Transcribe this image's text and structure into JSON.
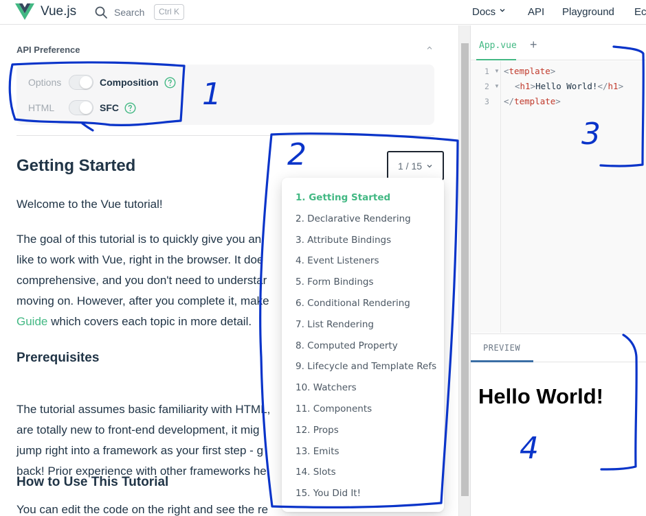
{
  "topnav": {
    "brand": "Vue.js",
    "search_label": "Search",
    "search_shortcut": "Ctrl K",
    "items": [
      "Docs",
      "API",
      "Playground",
      "Ec"
    ]
  },
  "api_preference": {
    "header": "API Preference",
    "row1": {
      "off": "Options",
      "on": "Composition"
    },
    "row2": {
      "off": "HTML",
      "on": "SFC"
    }
  },
  "tutorial": {
    "title": "Getting Started",
    "step": "1 / 15",
    "paragraphs": {
      "p1": "Welcome to the Vue tutorial!",
      "p2_lines": [
        "The goal of this tutorial is to quickly give you an",
        "like to work with Vue, right in the browser. It doe",
        "comprehensive, and you don't need to understar",
        "moving on. However, after you complete it, make"
      ],
      "p2_link": "Guide",
      "p2_tail": " which covers each topic in more detail.",
      "h_prereq": "Prerequisites",
      "p3_lines": [
        "The tutorial assumes basic familiarity with HTML,",
        "are totally new to front-end development, it mig",
        "jump right into a framework as your first step - g",
        "back! Prior experience with other frameworks he"
      ],
      "h_howto": "How to Use This Tutorial",
      "p4": "You can edit the code on the right and see the re"
    },
    "steps": [
      "1. Getting Started",
      "2. Declarative Rendering",
      "3. Attribute Bindings",
      "4. Event Listeners",
      "5. Form Bindings",
      "6. Conditional Rendering",
      "7. List Rendering",
      "8. Computed Property",
      "9. Lifecycle and Template Refs",
      "10. Watchers",
      "11. Components",
      "12. Props",
      "13. Emits",
      "14. Slots",
      "15. You Did It!"
    ]
  },
  "editor": {
    "tab_file": "App.vue",
    "tab_add": "+",
    "line_numbers": [
      "1",
      "2",
      "3"
    ],
    "line1": {
      "open": "<",
      "tag": "template",
      "close": ">"
    },
    "line2": {
      "open": "<",
      "tag": "h1",
      "close": ">",
      "text": "Hello World!",
      "endopen": "</",
      "endtag": "h1",
      "endclose": ">"
    },
    "line3": {
      "open": "</",
      "tag": "template",
      "close": ">"
    }
  },
  "preview": {
    "tab": "PREVIEW",
    "heading": "Hello World!"
  },
  "annotations": [
    "1",
    "2",
    "3",
    "4"
  ],
  "colors": {
    "accent": "#42b883",
    "annotation": "#0a34c9",
    "text": "#213547"
  }
}
